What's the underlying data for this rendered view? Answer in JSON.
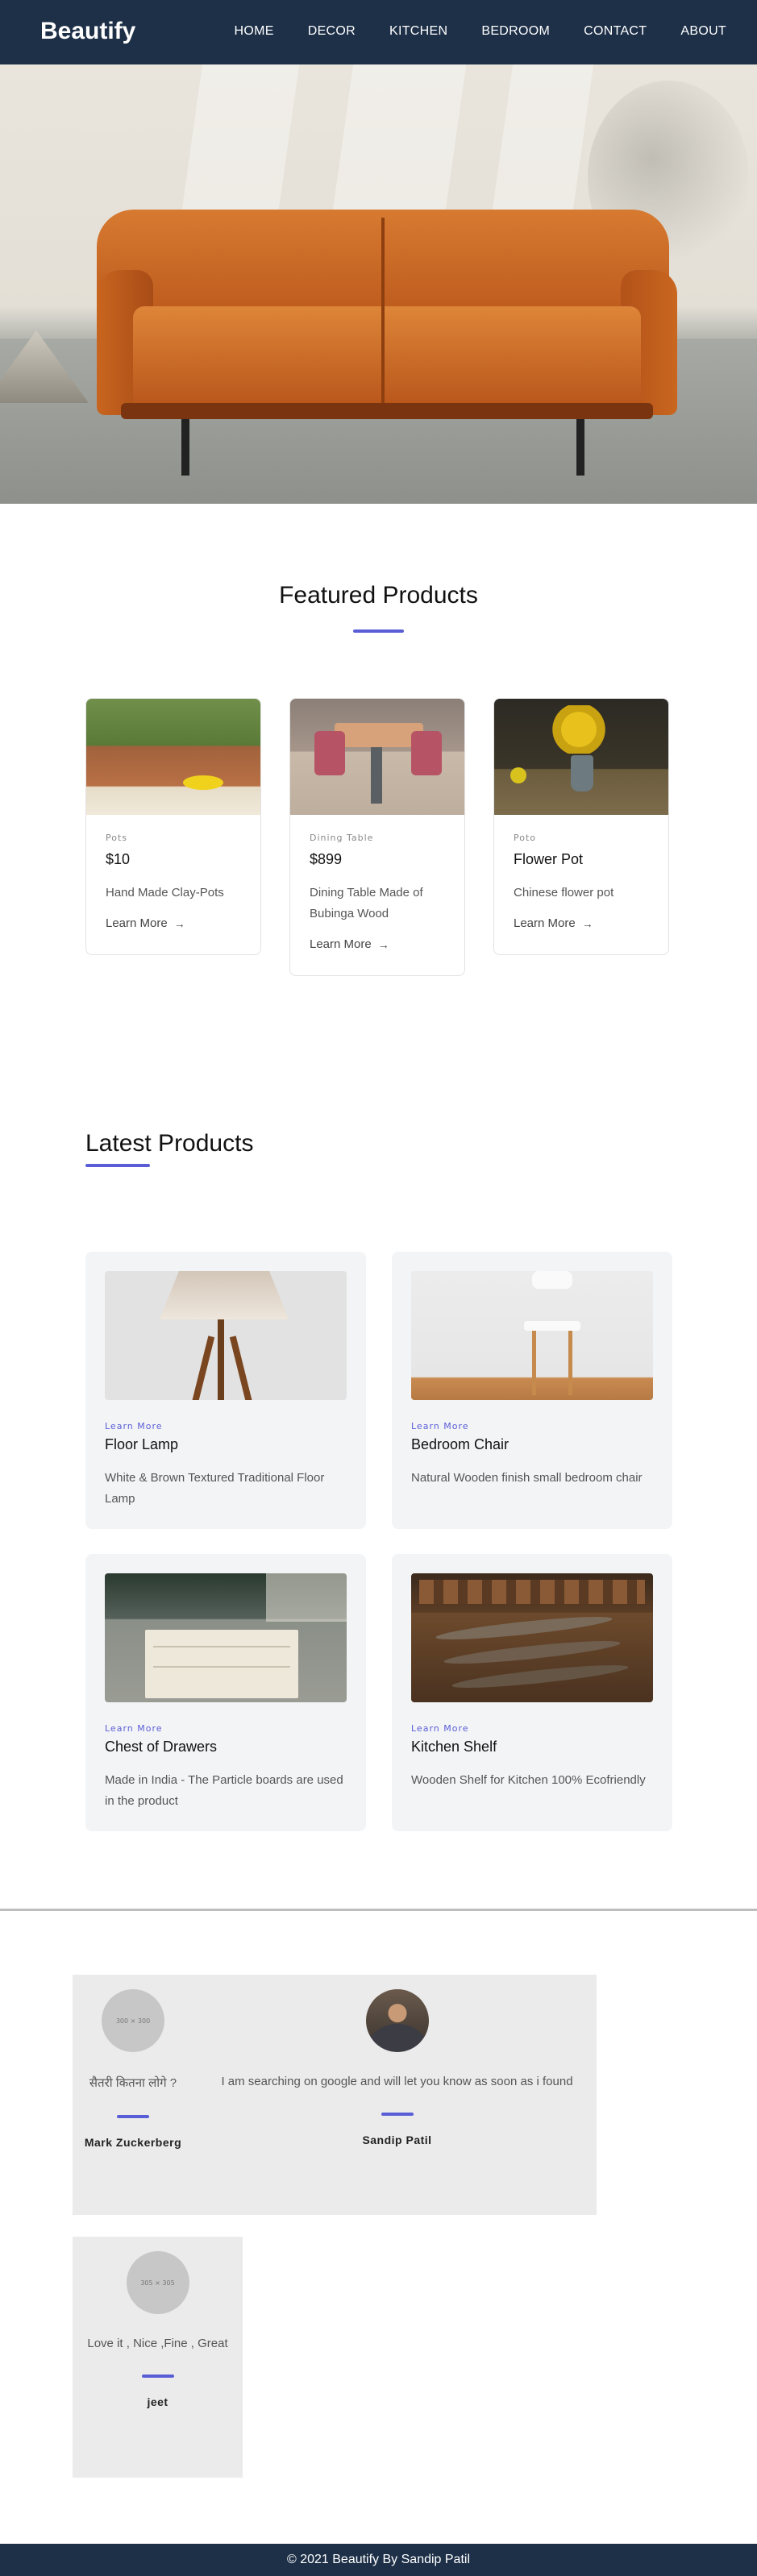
{
  "nav": {
    "brand": "Beautify",
    "links": [
      "HOME",
      "DECOR",
      "KITCHEN",
      "BEDROOM",
      "CONTACT",
      "ABOUT"
    ]
  },
  "featured": {
    "title": "Featured Products",
    "cards": [
      {
        "category": "Pots",
        "name": "$10",
        "description": "Hand Made Clay-Pots",
        "link": "Learn More",
        "image": "potted-plants-image"
      },
      {
        "category": "Dining Table",
        "name": "$899",
        "description": "Dining Table Made of Bubinga Wood",
        "link": "Learn More",
        "image": "dining-table-image"
      },
      {
        "category": "Poto",
        "name": "Flower Pot",
        "description": "Chinese flower pot",
        "link": "Learn More",
        "image": "sunflowers-image"
      }
    ]
  },
  "latest": {
    "title": "Latest Products",
    "cards": [
      {
        "link": "Learn More",
        "name": "Floor Lamp",
        "description": "White & Brown Textured Traditional Floor Lamp",
        "image": "floor-lamp-image"
      },
      {
        "link": "Learn More",
        "name": "Bedroom Chair",
        "description": "Natural Wooden finish small bedroom chair",
        "image": "wooden-chair-image"
      },
      {
        "link": "Learn More",
        "name": "Chest of Drawers",
        "description": "Made in India - The Particle boards are used in the product",
        "image": "kitchen-drawers-image"
      },
      {
        "link": "Learn More",
        "name": "Kitchen Shelf",
        "description": "Wooden Shelf for Kitchen 100% Ecofriendly",
        "image": "kitchen-shelf-image"
      }
    ]
  },
  "testimonials": [
    {
      "avatar_text": "300 × 300",
      "quote": "सैतरी कितना लोगे ?",
      "author": "Mark Zuckerberg"
    },
    {
      "avatar_text": "",
      "quote": "I am searching on google and will let you know as soon as i found",
      "author": "Sandip Patil"
    },
    {
      "avatar_text": "305 × 305",
      "quote": "Love it , Nice ,Fine , Great",
      "author": "jeet"
    }
  ],
  "footer": {
    "text": "© 2021 Beautify By Sandip Patil"
  },
  "colors": {
    "nav_bg": "#1e3048",
    "accent": "#5a5ed6",
    "card_bg": "#f3f4f6",
    "testimonial_bg": "#ecebeb"
  }
}
